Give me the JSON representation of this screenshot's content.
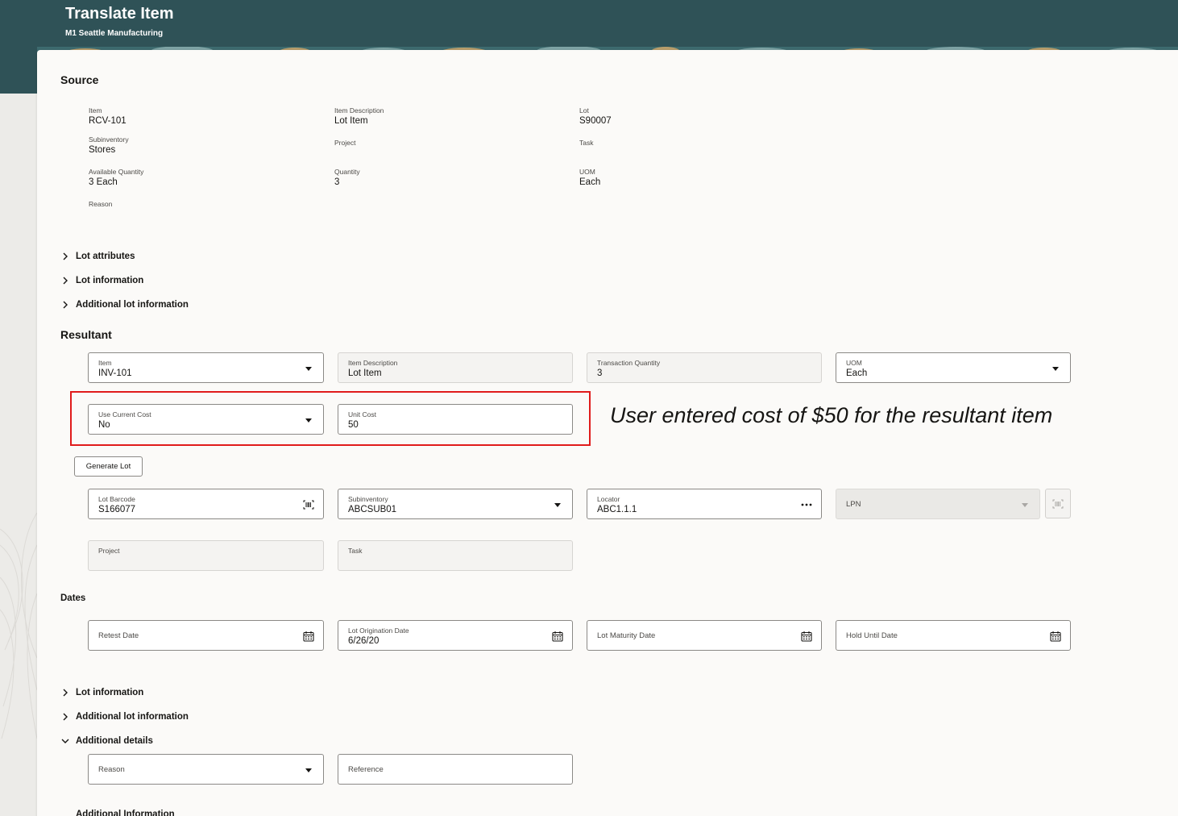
{
  "header": {
    "title": "Translate Item",
    "subtitle": "M1 Seattle Manufacturing"
  },
  "source": {
    "title": "Source",
    "fields": [
      {
        "label": "Item",
        "value": "RCV-101"
      },
      {
        "label": "Item Description",
        "value": "Lot Item"
      },
      {
        "label": "Lot",
        "value": "S90007"
      },
      {
        "label": "Subinventory",
        "value": "Stores"
      },
      {
        "label": "Project",
        "value": ""
      },
      {
        "label": "Task",
        "value": ""
      },
      {
        "label": "Available Quantity",
        "value": "3 Each"
      },
      {
        "label": "Quantity",
        "value": "3"
      },
      {
        "label": "UOM",
        "value": "Each"
      },
      {
        "label": "Reason",
        "value": ""
      }
    ],
    "accordions": [
      "Lot attributes",
      "Lot information",
      "Additional lot information"
    ]
  },
  "resultant": {
    "title": "Resultant",
    "item": {
      "label": "Item",
      "value": "INV-101"
    },
    "item_description": {
      "label": "Item Description",
      "value": "Lot Item"
    },
    "transaction_quantity": {
      "label": "Transaction Quantity",
      "value": "3"
    },
    "uom": {
      "label": "UOM",
      "value": "Each"
    },
    "use_current_cost": {
      "label": "Use Current Cost",
      "value": "No"
    },
    "unit_cost": {
      "label": "Unit Cost",
      "value": "50"
    },
    "generate_lot_label": "Generate Lot",
    "lot_barcode": {
      "label": "Lot Barcode",
      "value": "S166077"
    },
    "subinventory": {
      "label": "Subinventory",
      "value": "ABCSUB01"
    },
    "locator": {
      "label": "Locator",
      "value": "ABC1.1.1"
    },
    "lpn": {
      "placeholder": "LPN"
    },
    "project": {
      "label": "Project"
    },
    "task": {
      "label": "Task"
    },
    "dates_title": "Dates",
    "retest_date": {
      "placeholder": "Retest Date"
    },
    "lot_origination_date": {
      "label": "Lot Origination Date",
      "value": "6/26/20"
    },
    "lot_maturity_date": {
      "placeholder": "Lot Maturity Date"
    },
    "hold_until_date": {
      "placeholder": "Hold Until Date"
    },
    "accordions": [
      "Lot information",
      "Additional lot information",
      "Additional details"
    ],
    "reason": {
      "placeholder": "Reason"
    },
    "reference": {
      "placeholder": "Reference"
    },
    "cut_off_label": "Additional Information"
  },
  "annotation": {
    "text": "User entered cost of $50 for the resultant item",
    "color": "#e01b1b"
  },
  "colors": {
    "header": "#2f5257",
    "panel": "#fbfaf8"
  }
}
